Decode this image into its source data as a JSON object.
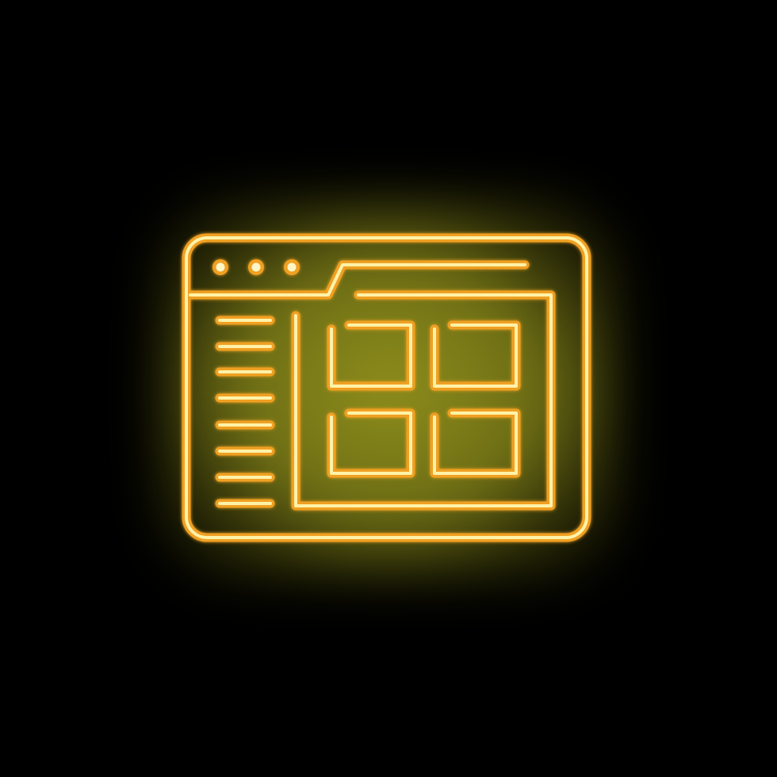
{
  "icon": {
    "name": "neon-browser-window-grid-icon",
    "description_visible": "",
    "colors": {
      "background": "#000000",
      "glow": "#8f8f1e",
      "stroke_outer": "#f0a020",
      "stroke_inner": "#fff2a8"
    },
    "parts": {
      "window_dots": 3,
      "sidebar_lines": 8,
      "grid_tiles": 4
    }
  }
}
